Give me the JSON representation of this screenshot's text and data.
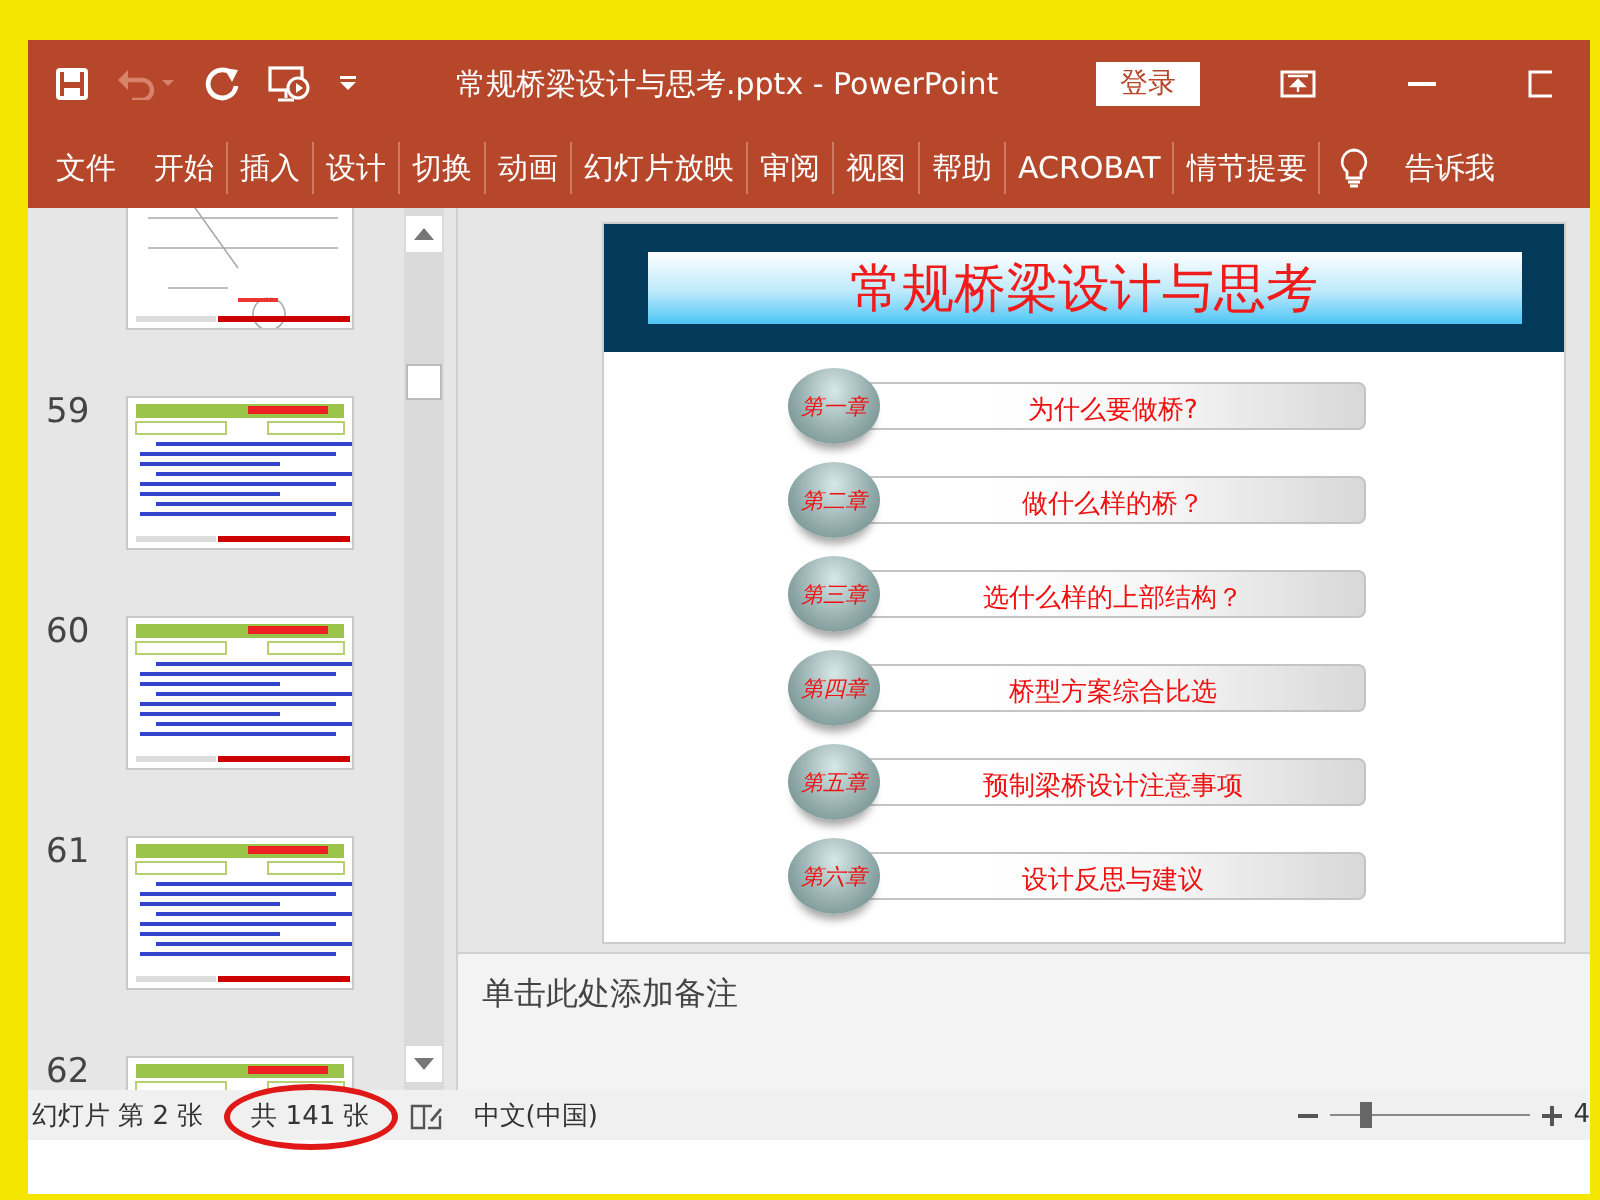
{
  "window": {
    "title": "常规桥梁设计与思考.pptx  -  PowerPoint",
    "login_button": "登录"
  },
  "quick_access": [
    {
      "kind": "save",
      "disabled": false
    },
    {
      "kind": "undo",
      "disabled": true
    },
    {
      "kind": "redo",
      "disabled": false
    },
    {
      "kind": "present",
      "disabled": false
    },
    {
      "kind": "customize",
      "disabled": false
    }
  ],
  "ribbon_tabs": [
    {
      "label": "文件"
    },
    {
      "label": "开始"
    },
    {
      "label": "插入"
    },
    {
      "label": "设计"
    },
    {
      "label": "切换"
    },
    {
      "label": "动画"
    },
    {
      "label": "幻灯片放映"
    },
    {
      "label": "审阅"
    },
    {
      "label": "视图"
    },
    {
      "label": "帮助"
    },
    {
      "label": "ACROBAT"
    },
    {
      "label": "情节提要"
    }
  ],
  "tell_me": "告诉我",
  "thumbnails": [
    {
      "kind": "diagram"
    },
    {
      "number": "59",
      "kind": "text"
    },
    {
      "number": "60",
      "kind": "text"
    },
    {
      "number": "61",
      "kind": "text"
    },
    {
      "number": "62",
      "kind": "text"
    }
  ],
  "slide": {
    "title": "常规桥梁设计与思考",
    "chapters": [
      {
        "badge": "第一章",
        "title": "为什么要做桥?"
      },
      {
        "badge": "第二章",
        "title": "做什么样的桥？"
      },
      {
        "badge": "第三章",
        "title": "选什么样的上部结构？"
      },
      {
        "badge": "第四章",
        "title": "桥型方案综合比选"
      },
      {
        "badge": "第五章",
        "title": "预制梁桥设计注意事项"
      },
      {
        "badge": "第六章",
        "title": "设计反思与建议"
      }
    ]
  },
  "notes_placeholder": "单击此处添加备注",
  "status_bar": {
    "slide_position": "幻灯片 第 2 张",
    "slide_count": "共 141 张",
    "slide_count_highlighted": true,
    "language": "中文(中国)",
    "zoom": {
      "level": 0.18
    },
    "zoom_reading": "4"
  }
}
